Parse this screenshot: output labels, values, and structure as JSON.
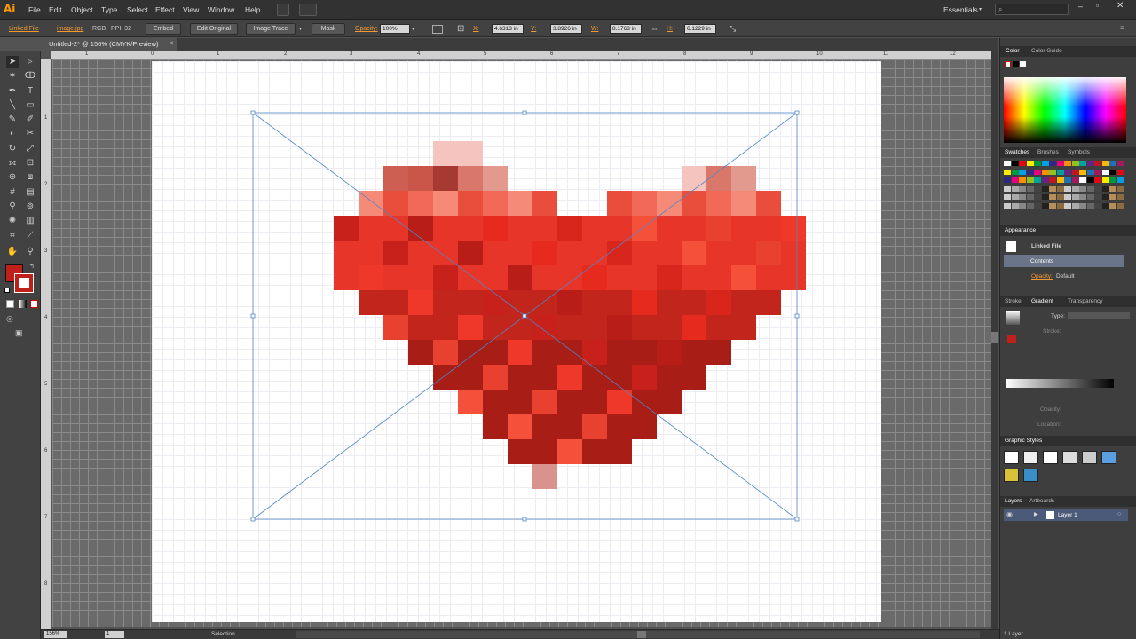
{
  "app": {
    "logo": "Ai"
  },
  "menu": [
    "File",
    "Edit",
    "Object",
    "Type",
    "Select",
    "Effect",
    "View",
    "Window",
    "Help"
  ],
  "workspace": {
    "label": "Essentials",
    "search_placeholder": ""
  },
  "control": {
    "linked_file": "Linked File",
    "image_link": "image.jpg",
    "color_mode": "RGB",
    "ppi": "PPI: 32",
    "embed": "Embed",
    "edit_original": "Edit Original",
    "image_trace": "Image Trace",
    "mask": "Mask",
    "opacity_label": "Opacity:",
    "opacity_value": "100%",
    "x_label": "X:",
    "x_value": "4.6313 in",
    "y_label": "Y:",
    "y_value": "3.8926 in",
    "w_label": "W:",
    "w_value": "8.1763 in",
    "h_label": "H:",
    "h_value": "6.1229 in"
  },
  "document": {
    "tab_title": "Untitled-2* @ 156% (CMYK/Preview)"
  },
  "rulers": {
    "h": [
      "1",
      "0",
      "1",
      "2",
      "3",
      "4",
      "5",
      "6",
      "7",
      "8",
      "9",
      "10",
      "11",
      "12"
    ],
    "v": [
      "1",
      "2",
      "3",
      "4",
      "5",
      "6",
      "7",
      "8"
    ]
  },
  "status": {
    "zoom": "156%",
    "artboard": "1",
    "tool": "Selection"
  },
  "panels": {
    "color_tabs": [
      "Color",
      "Color Guide"
    ],
    "swatch_tabs": [
      "Swatches",
      "Brushes",
      "Symbols"
    ],
    "appearance": {
      "title": "Appearance",
      "linked_file": "Linked File",
      "contents": "Contents",
      "opacity_label": "Opacity:",
      "opacity_value": "Default"
    },
    "stroke_tabs": [
      "Stroke",
      "Gradient",
      "Transparency"
    ],
    "gradient": {
      "type_label": "Type:",
      "stroke_label": "Stroke:",
      "opacity_label": "Opacity:",
      "location_label": "Location:"
    },
    "graphic_styles": {
      "title": "Graphic Styles"
    },
    "layers": {
      "tabs": [
        "Layers",
        "Artboards"
      ],
      "layer_name": "Layer 1",
      "count": "1 Layer"
    }
  },
  "colors": {
    "fill": "#c0201a",
    "selection": "#4f86c6"
  }
}
